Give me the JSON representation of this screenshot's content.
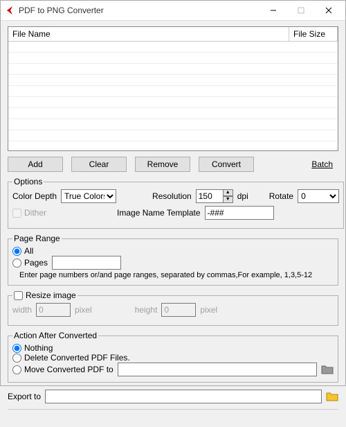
{
  "window": {
    "title": "PDF to PNG Converter"
  },
  "table": {
    "col_name": "File Name",
    "col_size": "File Size"
  },
  "buttons": {
    "add": "Add",
    "clear": "Clear",
    "remove": "Remove",
    "convert": "Convert",
    "batch": "Batch"
  },
  "options": {
    "legend": "Options",
    "color_depth_label": "Color Depth",
    "color_depth_value": "True Colors",
    "resolution_label": "Resolution",
    "resolution_value": "150",
    "resolution_unit": "dpi",
    "rotate_label": "Rotate",
    "rotate_value": "0",
    "dither_label": "Dither",
    "image_template_label": "Image Name Template",
    "image_template_value": "-###"
  },
  "page_range": {
    "legend": "Page Range",
    "all": "All",
    "pages": "Pages",
    "pages_value": "",
    "note": "Enter page numbers or/and page ranges, separated by commas,For example, 1,3,5-12"
  },
  "resize": {
    "label": "Resize image",
    "width_label": "width",
    "width_value": "0",
    "height_label": "height",
    "height_value": "0",
    "unit": "pixel"
  },
  "action": {
    "legend": "Action After Converted",
    "nothing": "Nothing",
    "delete": "Delete Converted PDF Files.",
    "move": "Move Converted PDF to",
    "move_path": ""
  },
  "export": {
    "label": "Export to",
    "value": ""
  }
}
